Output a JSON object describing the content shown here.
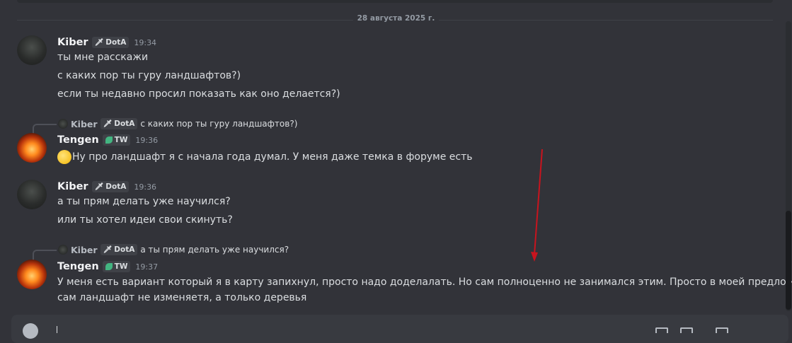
{
  "date_divider": "28 августа 2025 г.",
  "messages": [
    {
      "author": "Kiber",
      "tag": "DotA",
      "time": "19:34",
      "lines": [
        "ты мне расскажи",
        "с каких пор ты гуру ландшафтов?)",
        "если ты недавно просил показать как оно делается?)"
      ]
    },
    {
      "reply": {
        "author": "Kiber",
        "tag": "DotA",
        "text": "с каких пор ты гуру ландшафтов?)"
      },
      "author": "Tengen",
      "tag": "TW",
      "time": "19:36",
      "lines": [
        "Ну про ландшафт я с начала года думал. У меня даже темка в форуме есть"
      ]
    },
    {
      "author": "Kiber",
      "tag": "DotA",
      "time": "19:36",
      "lines": [
        "а ты прям делать уже научился?",
        "или ты хотел идеи свои скинуть?"
      ]
    },
    {
      "reply": {
        "author": "Kiber",
        "tag": "DotA",
        "text": "а ты прям делать уже научился?"
      },
      "author": "Tengen",
      "tag": "TW",
      "time": "19:37",
      "lines": [
        "У меня есть вариант который я в карту запихнул, просто надо доделалать. Но сам полноценно не занимался этим. Просто в моей предложке",
        "сам ландшафт не изменяетя, а только деревья"
      ]
    }
  ],
  "icons": {
    "dota_tag_icon": "sword-icon",
    "tw_tag_icon": "leaf-icon",
    "emoji": "grinning-sweat-emoji"
  },
  "annotation": {
    "arrow_color": "#c8141e"
  }
}
